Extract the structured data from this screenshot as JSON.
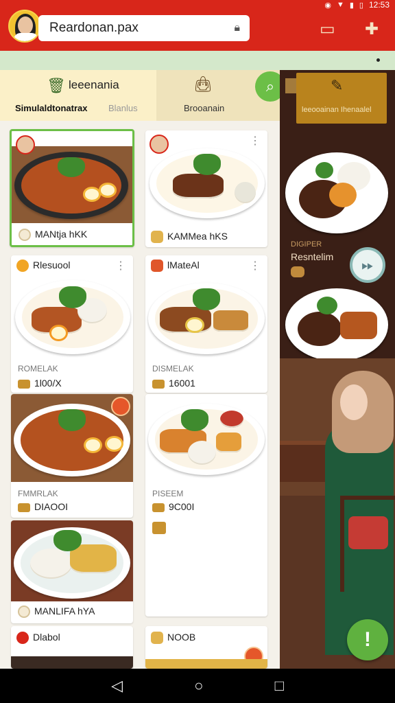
{
  "status": {
    "time": "12:53"
  },
  "header": {
    "search_text": "Reardonan.pax",
    "icons": [
      "lock-icon",
      "clipboard-icon",
      "tool-icon"
    ]
  },
  "tabs": {
    "tab1_title": "leeenania",
    "tab1_sub_active": "Simulaldtonatrax",
    "tab1_sub_inactive": "Blanlus",
    "tab2_title": "Brooanain"
  },
  "right_panel": {
    "tab_label": "leeooainan Ihenaalel",
    "label_small": "DIGIPER",
    "label_main": "Resntelim"
  },
  "cards": [
    {
      "title": "MANtja hKK"
    },
    {
      "title": "KAMMea hKS"
    },
    {
      "title": "Rlesuool",
      "meta": "ROMELAK",
      "price": "1l00/X"
    },
    {
      "title": "lMateAl",
      "meta": "DISMELAK",
      "price": "16001"
    },
    {
      "meta": "FMMRLAK",
      "price": "DIAOOI"
    },
    {
      "meta": "PISEEM",
      "price": "9C00I"
    },
    {
      "title": "MANLIFA hYA"
    },
    {
      "title": "Dlabol"
    },
    {
      "title": "NOOB"
    }
  ],
  "colors": {
    "brand_red": "#d8261a",
    "accent_green": "#6cbf47"
  }
}
